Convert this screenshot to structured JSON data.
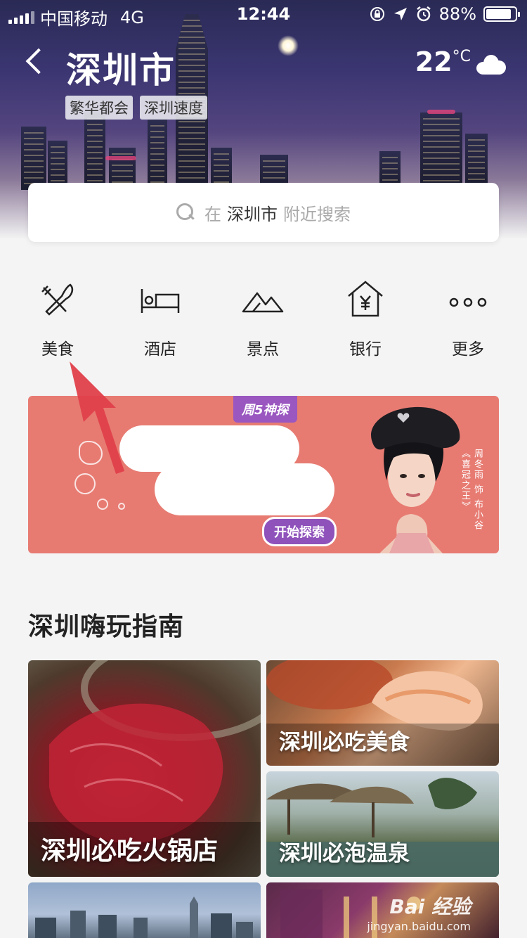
{
  "status_bar": {
    "carrier": "中国移动",
    "network": "4G",
    "time": "12:44",
    "battery": "88%",
    "battery_level": 0.88
  },
  "header": {
    "city": "深圳市",
    "tags": [
      "繁华都会",
      "深圳速度"
    ],
    "temperature": "22",
    "temp_unit": "°C",
    "weather_icon": "cloud-icon"
  },
  "search": {
    "prefix": "在",
    "city": "深圳市",
    "suffix": "附近搜索",
    "icon": "search-icon"
  },
  "categories": [
    {
      "label": "美食",
      "icon": "fork-knife-icon"
    },
    {
      "label": "酒店",
      "icon": "bed-icon"
    },
    {
      "label": "景点",
      "icon": "mountain-icon"
    },
    {
      "label": "银行",
      "icon": "bank-icon"
    },
    {
      "label": "更多",
      "icon": "more-dots-icon"
    }
  ],
  "banner": {
    "badge": "周5神探",
    "button": "开始探索",
    "side_text_1": "周冬雨 饰 布小谷",
    "side_text_2": "《喜冠之王》"
  },
  "guide": {
    "title": "深圳嗨玩指南",
    "tiles": [
      "深圳必吃火锅店",
      "深圳必吃美食",
      "深圳必泡温泉"
    ]
  },
  "watermark": {
    "line1": "Bai 经验",
    "line2": "jingyan.baidu.com"
  },
  "colors": {
    "banner_bg": "#e77b72",
    "accent_purple": "#8f52bb",
    "arrow_red": "#e0404a"
  }
}
